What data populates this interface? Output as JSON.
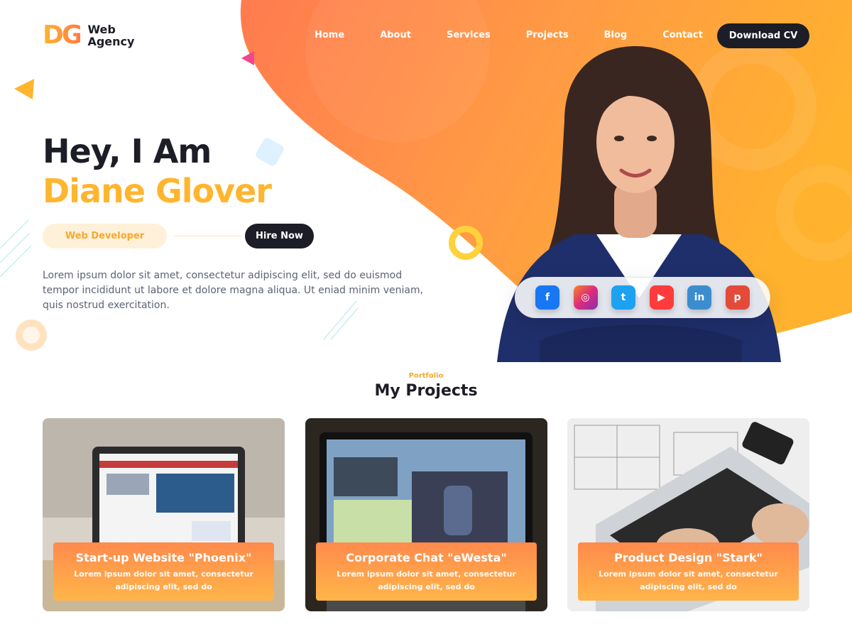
{
  "brand": {
    "mark": "DG",
    "line1": "Web",
    "line2": "Agency"
  },
  "nav": {
    "items": [
      {
        "label": "Home"
      },
      {
        "label": "About"
      },
      {
        "label": "Services"
      },
      {
        "label": "Projects"
      },
      {
        "label": "Blog"
      },
      {
        "label": "Contact"
      }
    ],
    "cta_label": "Download CV"
  },
  "hero": {
    "greeting": "Hey, I Am",
    "name": "Diane Glover",
    "role": "Web Developer",
    "hire_label": "Hire Now",
    "description": "Lorem ipsum dolor sit amet, consectetur adipiscing elit, sed do euismod tempor incididunt ut labore et dolore magna aliqua. Ut eniad minim veniam, quis nostrud exercitation."
  },
  "social": [
    {
      "icon": "facebook-icon",
      "glyph": "f",
      "color": "#1877f2"
    },
    {
      "icon": "instagram-icon",
      "glyph": "◎",
      "color": "#e1306c"
    },
    {
      "icon": "twitter-icon",
      "glyph": "t",
      "color": "#1da1f2"
    },
    {
      "icon": "youtube-icon",
      "glyph": "▶",
      "color": "#ff3b3b"
    },
    {
      "icon": "linkedin-icon",
      "glyph": "in",
      "color": "#3c8dd0"
    },
    {
      "icon": "pinterest-icon",
      "glyph": "p",
      "color": "#e34a3a"
    }
  ],
  "projects_section": {
    "kicker": "Portfolio",
    "title": "My Projects",
    "cards": [
      {
        "title": "Start-up Website \"Phoenix\"",
        "desc": "Lorem ipsum dolor sit amet, consectetur adipiscing elit, sed do"
      },
      {
        "title": "Corporate Chat \"eWesta\"",
        "desc": "Lorem ipsum dolor sit amet, consectetur adipiscing elit, sed do"
      },
      {
        "title": "Product Design \"Stark\"",
        "desc": "Lorem ipsum dolor sit amet, consectetur adipiscing elit, sed do"
      }
    ]
  },
  "colors": {
    "accent": "#ffb52e",
    "accent_alt": "#ff7a45",
    "dark": "#1c1d26"
  }
}
